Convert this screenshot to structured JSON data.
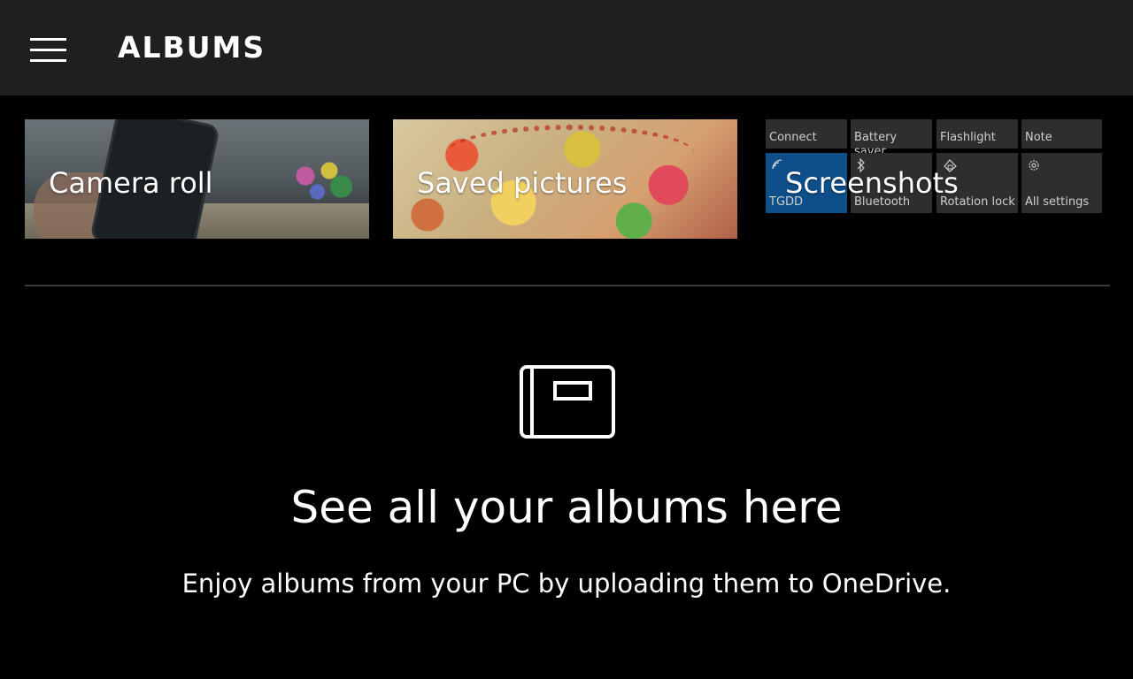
{
  "header": {
    "title": "ALBUMS",
    "menu_icon": "hamburger-menu-icon",
    "background": "#1f1f1f"
  },
  "albums": [
    {
      "label": "Camera roll"
    },
    {
      "label": "Saved pictures"
    },
    {
      "label": "Screenshots"
    }
  ],
  "screenshot_preview": {
    "quick_actions": [
      {
        "label": "Connect",
        "icon": ""
      },
      {
        "label": "Battery saver",
        "icon": ""
      },
      {
        "label": "Flashlight",
        "icon": ""
      },
      {
        "label": "Note",
        "icon": ""
      },
      {
        "label": "TGDD",
        "icon": "wifi-icon",
        "active": true
      },
      {
        "label": "Bluetooth",
        "icon": "bluetooth-icon"
      },
      {
        "label": "Rotation lock",
        "icon": "rotation-lock-icon"
      },
      {
        "label": "All settings",
        "icon": "gear-icon"
      }
    ],
    "accent_color": "#0e4f8a"
  },
  "empty_state": {
    "icon": "album-icon",
    "heading": "See all your albums here",
    "subtext": "Enjoy albums from your PC by uploading them to OneDrive."
  }
}
